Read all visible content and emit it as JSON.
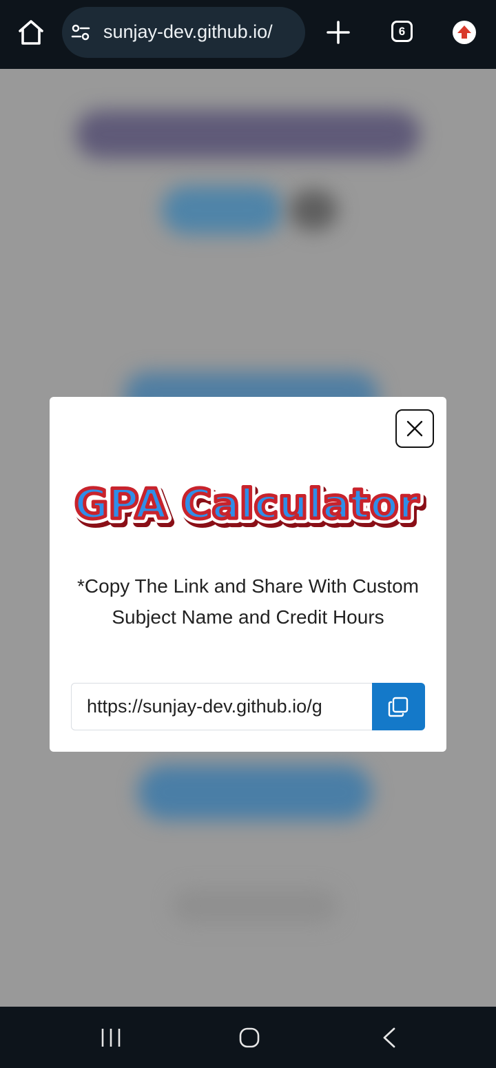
{
  "browser": {
    "url": "sunjay-dev.github.io/",
    "tab_count": "6"
  },
  "modal": {
    "logo_text": "GPA Calculator",
    "message": "*Copy The Link and Share With Custom Subject Name and Credit Hours",
    "share_link": "https://sunjay-dev.github.io/g"
  },
  "colors": {
    "accent_blue": "#1479c9",
    "logo_blue": "#2f8ee8",
    "logo_red": "#c8232c",
    "bar_dark": "#0d141b"
  }
}
